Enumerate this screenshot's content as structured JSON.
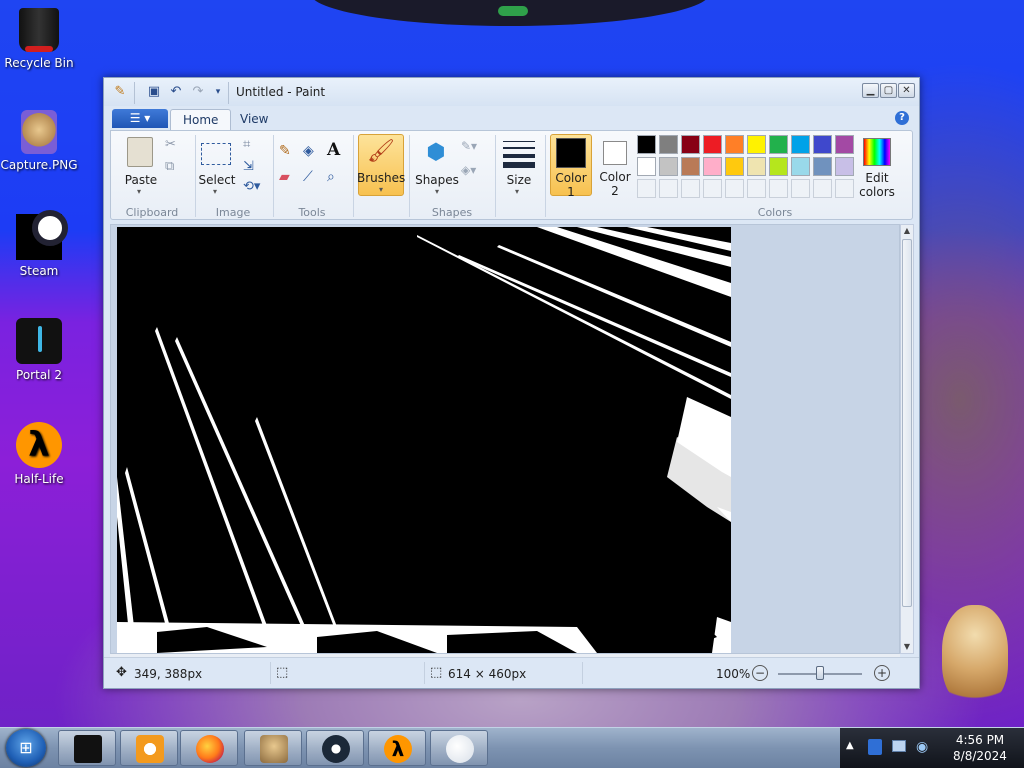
{
  "desktop": {
    "icons": [
      {
        "label": "Recycle Bin"
      },
      {
        "label": "Capture.PNG"
      },
      {
        "label": "Steam"
      },
      {
        "label": "Portal 2"
      },
      {
        "label": "Half-Life"
      }
    ]
  },
  "window": {
    "title": "Untitled - Paint",
    "tabs": {
      "home": "Home",
      "view": "View"
    },
    "help": "?"
  },
  "ribbon": {
    "clipboard": {
      "paste": "Paste",
      "group": "Clipboard"
    },
    "image": {
      "select": "Select",
      "group": "Image"
    },
    "tools": {
      "group": "Tools"
    },
    "brushes": {
      "label": "Brushes"
    },
    "shapes": {
      "label": "Shapes",
      "group": "Shapes"
    },
    "size": {
      "label": "Size"
    },
    "color1": {
      "label1": "Color",
      "label2": "1",
      "value": "#000000"
    },
    "color2": {
      "label1": "Color",
      "label2": "2",
      "value": "#ffffff"
    },
    "colors": {
      "group": "Colors",
      "row1": [
        "#000000",
        "#7f7f7f",
        "#880015",
        "#ed1c24",
        "#ff7f27",
        "#fff200",
        "#22b14c",
        "#00a2e8",
        "#3f48cc",
        "#a349a4"
      ],
      "row2": [
        "#ffffff",
        "#c3c3c3",
        "#b97a57",
        "#ffaec9",
        "#ffc90e",
        "#efe4b0",
        "#b5e61d",
        "#99d9ea",
        "#7092be",
        "#c8bfe7"
      ]
    },
    "edit_colors": {
      "label1": "Edit",
      "label2": "colors"
    }
  },
  "status": {
    "cursor_pos": "349, 388px",
    "image_size": "614 × 460px",
    "zoom": "100%",
    "zoom_slider_value": 0.5
  },
  "taskbar": {
    "time": "4:56 PM",
    "date": "8/8/2024"
  }
}
